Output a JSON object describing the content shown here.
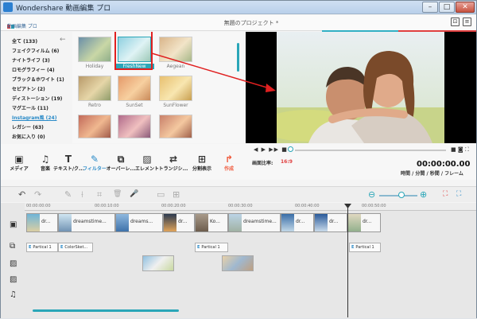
{
  "window": {
    "title": "Wondershare 動画編集 プロ",
    "min": "–",
    "max": "□",
    "close": "✕"
  },
  "header": {
    "logo_text": "動画編集 プロ",
    "project_title": "無題のプロジェクト *",
    "save_icon": "⊡",
    "menu_icon": "≡"
  },
  "categories": [
    {
      "label": "全て (133)"
    },
    {
      "label": "フェイクフィルム (6)"
    },
    {
      "label": "ナイトライフ (3)"
    },
    {
      "label": "ロモグラフィー (4)"
    },
    {
      "label": "ブラック＆ホワイト (1)"
    },
    {
      "label": "セピアトン (2)"
    },
    {
      "label": "ディストーション (19)"
    },
    {
      "label": "マグエール (11)"
    },
    {
      "label": "Instagram風 (24)",
      "active": true
    },
    {
      "label": "レガシー (63)"
    },
    {
      "label": "お気に入り (0)"
    }
  ],
  "back_icon": "←",
  "thumbnails": {
    "labels": [
      "Holiday",
      "FreshNew",
      "Aegean",
      "Retro",
      "SunSet",
      "SunFlower"
    ]
  },
  "toolbar": [
    {
      "icon": "▣",
      "label": "メディア"
    },
    {
      "icon": "♫",
      "label": "音楽"
    },
    {
      "icon": "T",
      "label": "テキスト/ク..."
    },
    {
      "icon": "✎",
      "label": "フィルター",
      "active": true
    },
    {
      "icon": "⧉",
      "label": "オーバーレ..."
    },
    {
      "icon": "▨",
      "label": "エレメント"
    },
    {
      "icon": "⇄",
      "label": "トランジシ..."
    },
    {
      "icon": "⊞",
      "label": "分割表示"
    },
    {
      "icon": "↱",
      "label": "作成",
      "export": true
    }
  ],
  "player": {
    "controls": "◀ ▶ ▶▶ ■",
    "controls_right": "■ ◙ ⛶",
    "aspect_label": "画面比率:",
    "aspect_value": "16:9",
    "timecode": "00:00:00.00",
    "time_format": "時間 / 分間 / 秒間 / フレーム"
  },
  "edit_bar": {
    "undo": "↶",
    "redo": "↷",
    "pen": "✎",
    "split": "⟊",
    "crop": "⌗",
    "trash": "🗑",
    "mic": "🎤",
    "detach": "▭",
    "grid": "⊞",
    "zoom_out": "⊖",
    "zoom_in": "⊕",
    "fit": "⛶",
    "zoom_level": 0.5
  },
  "ruler": [
    "00:00:00:00",
    "00:00:10:00",
    "00:00:20:00",
    "00:00:30:00",
    "00:00:40:00",
    "00:00:50:00"
  ],
  "tracks": {
    "icons": [
      "▣",
      "⧉",
      "▨",
      "▨",
      "♫"
    ],
    "video_clips": [
      {
        "label": "dr..."
      },
      {
        "label": "dreamstime..."
      },
      {
        "label": "dreams..."
      },
      {
        "label": "dr..."
      },
      {
        "label": "Ko..."
      },
      {
        "label": "dreamstime..."
      },
      {
        "label": "dr..."
      },
      {
        "label": "dr..."
      },
      {
        "label": "dr..."
      }
    ],
    "text_clips": [
      {
        "mark": "E",
        "label": "Partical 1"
      },
      {
        "mark": "E",
        "label": "ColorSket..."
      },
      {
        "mark": "E",
        "label": "Partical 1"
      },
      {
        "mark": "E",
        "label": "Partical 1"
      }
    ]
  },
  "colors": {
    "accent": "#2aa6b8",
    "highlight": "#e02020",
    "export": "#f05a3c"
  }
}
